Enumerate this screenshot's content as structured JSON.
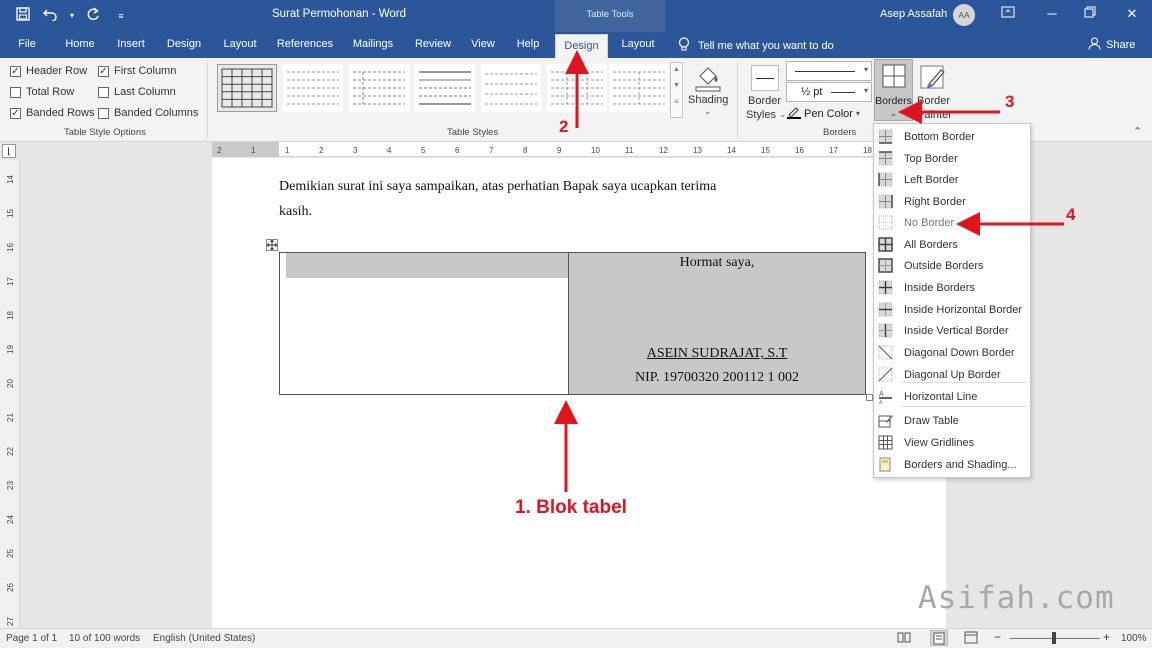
{
  "titlebar": {
    "document_title": "Surat Permohonan  -  Word",
    "context_tab": "Table Tools",
    "user_name": "Asep Assafah",
    "user_initials": "AA",
    "qat_icons": [
      "save-icon",
      "undo-icon",
      "redo-icon",
      "customize-icon"
    ]
  },
  "tabs": [
    {
      "label": "File"
    },
    {
      "label": "Home"
    },
    {
      "label": "Insert"
    },
    {
      "label": "Design"
    },
    {
      "label": "Layout"
    },
    {
      "label": "References"
    },
    {
      "label": "Mailings"
    },
    {
      "label": "Review"
    },
    {
      "label": "View"
    },
    {
      "label": "Help"
    },
    {
      "label": "Design",
      "active": true
    },
    {
      "label": "Layout"
    }
  ],
  "tell_me": "Tell me what you want to do",
  "share_label": "Share",
  "ribbon": {
    "style_options": {
      "items": [
        {
          "label": "Header Row",
          "checked": true
        },
        {
          "label": "First Column",
          "checked": true
        },
        {
          "label": "Total Row",
          "checked": false
        },
        {
          "label": "Last Column",
          "checked": false
        },
        {
          "label": "Banded Rows",
          "checked": true
        },
        {
          "label": "Banded Columns",
          "checked": false
        }
      ],
      "group_label": "Table Style Options"
    },
    "table_styles": {
      "group_label": "Table Styles"
    },
    "shading_label": "Shading",
    "border_styles": {
      "label_line1": "Border",
      "label_line2": "Styles"
    },
    "line_weight": "½ pt",
    "pen_color": "Pen Color",
    "borders_button": "Borders",
    "border_painter": {
      "line1": "Border",
      "line2": "Painter"
    },
    "borders_group_label": "Borders"
  },
  "document": {
    "line1": "Demikian surat ini saya sampaikan, atas perhatian Bapak saya ucapkan terima",
    "line2": "kasih.",
    "table": {
      "closing": "Hormat saya,",
      "name": "ASEIN SUDRAJAT, S.T",
      "nip": "NIP. 19700320 200112 1 002"
    }
  },
  "border_menu": {
    "items": [
      {
        "label": "Bottom Border",
        "icon": "bottom-border-icon"
      },
      {
        "label": "Top Border",
        "icon": "top-border-icon"
      },
      {
        "label": "Left Border",
        "icon": "left-border-icon"
      },
      {
        "label": "Right Border",
        "icon": "right-border-icon"
      },
      {
        "label": "No Border",
        "icon": "no-border-icon"
      },
      {
        "label": "All Borders",
        "icon": "all-borders-icon"
      },
      {
        "label": "Outside Borders",
        "icon": "outside-borders-icon"
      },
      {
        "label": "Inside Borders",
        "icon": "inside-borders-icon"
      },
      {
        "label": "Inside Horizontal Border",
        "icon": "inside-horizontal-border-icon"
      },
      {
        "label": "Inside Vertical Border",
        "icon": "inside-vertical-border-icon"
      },
      {
        "label": "Diagonal Down Border",
        "icon": "diagonal-down-border-icon"
      },
      {
        "label": "Diagonal Up Border",
        "icon": "diagonal-up-border-icon"
      },
      {
        "label": "Horizontal Line",
        "icon": "horizontal-line-icon"
      },
      {
        "label": "Draw Table",
        "icon": "draw-table-icon"
      },
      {
        "label": "View Gridlines",
        "icon": "view-gridlines-icon"
      },
      {
        "label": "Borders and Shading...",
        "icon": "borders-shading-icon"
      }
    ]
  },
  "annotations": {
    "step1": "1. Blok tabel",
    "step2": "2",
    "step3": "3",
    "step4": "4",
    "color": "#e0141e"
  },
  "ruler": {
    "horizontal_labels": [
      "2",
      "1",
      "1",
      "2",
      "3",
      "4",
      "5",
      "6",
      "7",
      "8",
      "9",
      "10",
      "11",
      "12",
      "13",
      "14",
      "15",
      "16",
      "17",
      "18"
    ],
    "vertical_labels": [
      "14",
      "15",
      "16",
      "17",
      "18",
      "19",
      "20",
      "21",
      "22",
      "23",
      "24",
      "25",
      "26",
      "27"
    ]
  },
  "statusbar": {
    "page": "Page 1 of 1",
    "words": "10 of 100 words",
    "language": "English (United States)",
    "zoom": "100%"
  },
  "watermark": "Asifah.com",
  "colors": {
    "word_blue": "#2b579a",
    "selection_gray": "#c8c8c8",
    "annotation_red": "#e0141e"
  }
}
